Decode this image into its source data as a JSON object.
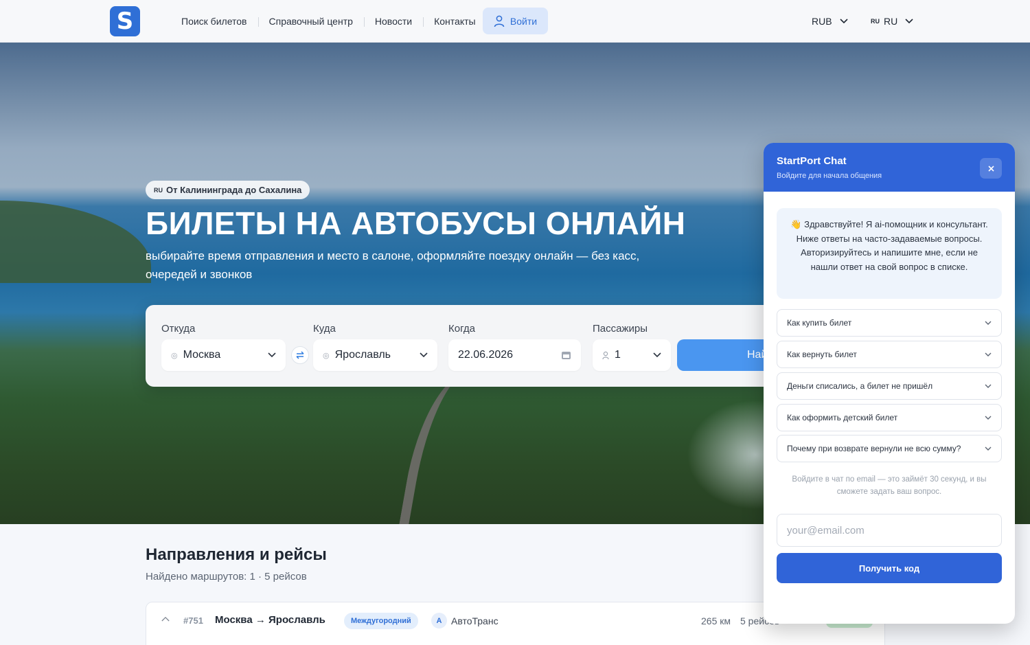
{
  "header": {
    "logo_letter": "S",
    "nav": [
      "Поиск билетов",
      "Справочный центр",
      "Новости",
      "Контакты"
    ],
    "login_label": "Войти",
    "currency": "RUB",
    "lang_code_small": "RU",
    "lang": "RU"
  },
  "hero": {
    "badge_code": "RU",
    "badge_text": "От Калининграда до Сахалина",
    "title": "БИЛЕТЫ НА АВТОБУСЫ ОНЛАЙН",
    "subtitle": "выбирайте время отправления и место в салоне, оформляйте поездку онлайн — без касс, очередей и звонков"
  },
  "search": {
    "from_label": "Откуда",
    "from_value": "Москва",
    "to_label": "Куда",
    "to_value": "Ярославль",
    "date_label": "Когда",
    "date_value": "22.06.2026",
    "pax_label": "Пассажиры",
    "pax_value": "1",
    "find_label": "Найти"
  },
  "directions": {
    "title": "Направления и рейсы",
    "subtitle": "Найдено маршрутов: 1 · 5 рейсов",
    "routes": [
      {
        "number": "#751",
        "name": "Москва → Ярославль",
        "tag": "Междугородний",
        "carrier_initial": "A",
        "carrier": "АвтоТранс",
        "distance": "265 км",
        "trips": "5 рейсов"
      }
    ]
  },
  "chat": {
    "title": "StartPort Chat",
    "subtitle": "Войдите для начала общения",
    "greeting": "👋 Здравствуйте! Я ai-помощник и консультант. Ниже ответы на часто-задаваемые вопросы. Авторизируйтесь и напишите мне, если не нашли ответ на свой вопрос в списке.",
    "faq": [
      "Как купить билет",
      "Как вернуть билет",
      "Деньги списались, а билет не пришёл",
      "Как оформить детский билет",
      "Почему при возврате вернули не всю сумму?"
    ],
    "note": "Войдите в чат по email — это займёт 30 секунд, и вы сможете задать ваш вопрос.",
    "email_placeholder": "your@email.com",
    "code_button": "Получить код"
  },
  "colors": {
    "brand": "#2f6fd6",
    "chat_header": "#3064d8",
    "find_button": "#4a96f0"
  }
}
